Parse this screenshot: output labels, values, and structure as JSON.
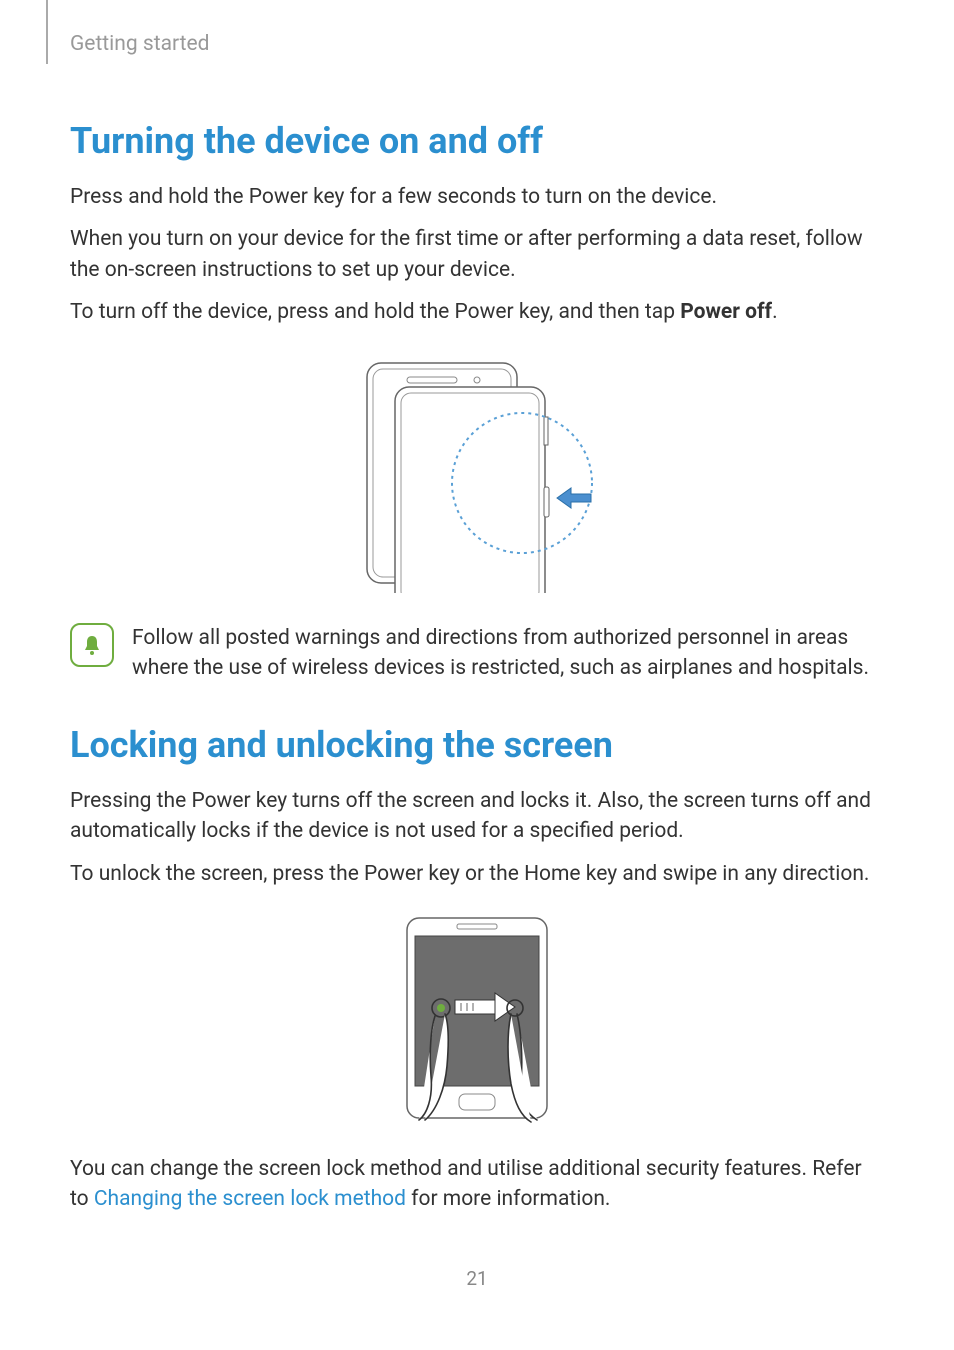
{
  "header": {
    "section": "Getting started"
  },
  "s1": {
    "title": "Turning the device on and off",
    "p1": "Press and hold the Power key for a few seconds to turn on the device.",
    "p2": "When you turn on your device for the first time or after performing a data reset, follow the on-screen instructions to set up your device.",
    "p3a": "To turn off the device, press and hold the Power key, and then tap ",
    "p3b": "Power off",
    "p3c": ".",
    "note": "Follow all posted warnings and directions from authorized personnel in areas where the use of wireless devices is restricted, such as airplanes and hospitals."
  },
  "s2": {
    "title": "Locking and unlocking the screen",
    "p1": "Pressing the Power key turns off the screen and locks it. Also, the screen turns off and automatically locks if the device is not used for a specified period.",
    "p2": "To unlock the screen, press the Power key or the Home key and swipe in any direction.",
    "p3a": "You can change the screen lock method and utilise additional security features. Refer to ",
    "p3link": "Changing the screen lock method",
    "p3b": " for more information."
  },
  "page_number": "21"
}
